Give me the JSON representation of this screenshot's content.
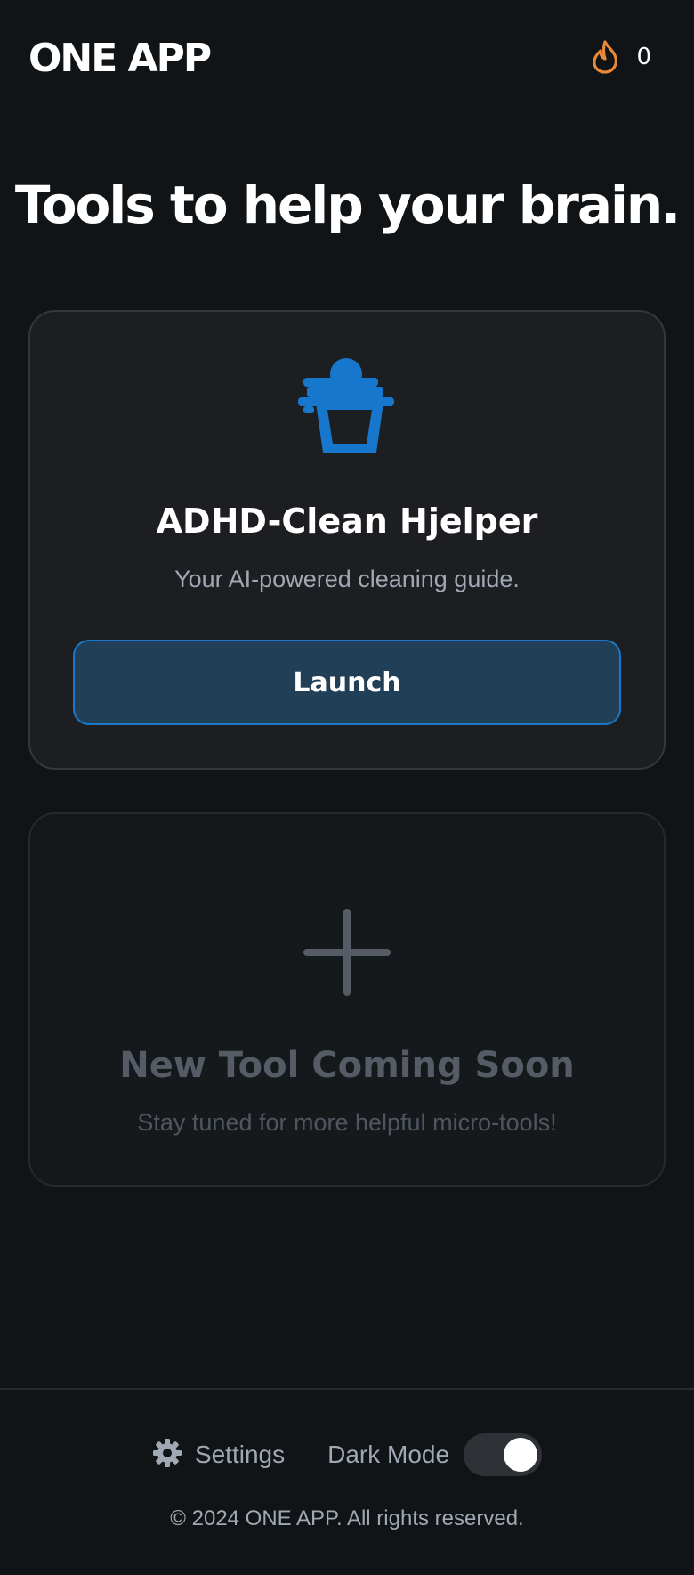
{
  "header": {
    "brand": "ONE APP",
    "streak_icon": "flame-icon",
    "streak_count": "0",
    "streak_color": "#e8893a"
  },
  "main": {
    "title": "Tools to help your brain.",
    "tools": [
      {
        "icon": "cleaning-bucket-icon",
        "icon_color": "#1677cc",
        "name": "ADHD-Clean Hjelper",
        "description": "Your AI-powered cleaning guide.",
        "button_label": "Launch"
      }
    ],
    "placeholder": {
      "icon": "plus-icon",
      "title": "New Tool Coming Soon",
      "description": "Stay tuned for more helpful micro-tools!"
    }
  },
  "footer": {
    "settings_icon": "gear-icon",
    "settings_label": "Settings",
    "dark_mode_label": "Dark Mode",
    "dark_mode_on": true,
    "copyright": "© 2024 ONE APP. All rights reserved."
  },
  "colors": {
    "background": "#111417",
    "card": "#1c1e21",
    "accent": "#1677cc",
    "button_bg": "#223f58",
    "muted_text": "#a0a8b3"
  }
}
